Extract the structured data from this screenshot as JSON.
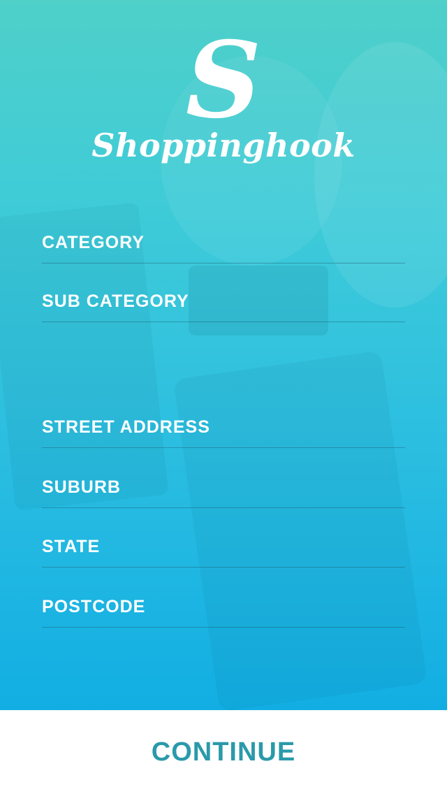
{
  "brand": {
    "mark": "S",
    "name": "Shoppinghook"
  },
  "form": {
    "fields": [
      {
        "label": "CATEGORY"
      },
      {
        "label": "SUB CATEGORY"
      },
      {
        "label": "STREET ADDRESS"
      },
      {
        "label": "SUBURB"
      },
      {
        "label": "STATE"
      },
      {
        "label": "POSTCODE"
      }
    ]
  },
  "footer": {
    "continue_label": "CONTINUE"
  },
  "colors": {
    "accent": "#2a9aaa",
    "background_top": "#4fd0c9",
    "background_bottom": "#12aee3"
  }
}
